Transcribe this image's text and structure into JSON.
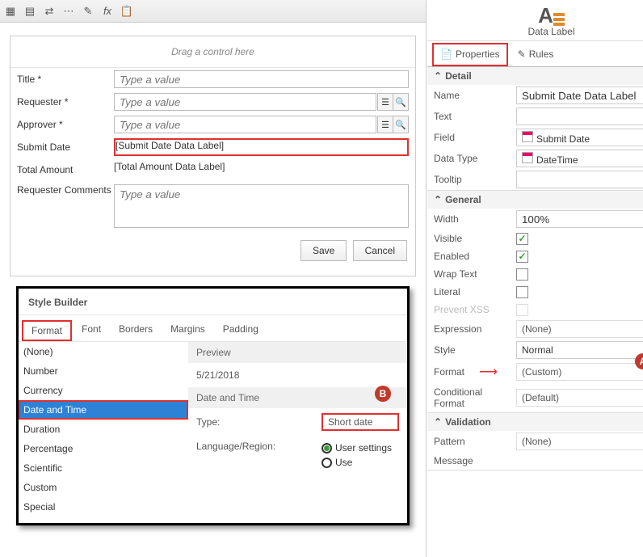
{
  "toolbar_icons": [
    "grid-icon",
    "grid-edit-icon",
    "link-icon",
    "dots-icon",
    "wand-icon",
    "fx-icon",
    "clipboard-icon"
  ],
  "canvas": {
    "drag_hint": "Drag a control here",
    "rows": {
      "title": {
        "label": "Title *",
        "placeholder": "Type a value"
      },
      "requester": {
        "label": "Requester *",
        "placeholder": "Type a value"
      },
      "approver": {
        "label": "Approver *",
        "placeholder": "Type a value"
      },
      "submit": {
        "label": "Submit Date",
        "value": "[Submit Date Data Label]"
      },
      "total": {
        "label": "Total Amount",
        "value": "[Total Amount Data Label]"
      },
      "comments": {
        "label": "Requester Comments",
        "placeholder": "Type a value"
      }
    },
    "buttons": {
      "save": "Save",
      "cancel": "Cancel"
    }
  },
  "style_builder": {
    "title": "Style Builder",
    "tabs": [
      "Format",
      "Font",
      "Borders",
      "Margins",
      "Padding"
    ],
    "cats": [
      "(None)",
      "Number",
      "Currency",
      "Date and Time",
      "Duration",
      "Percentage",
      "Scientific",
      "Custom",
      "Special"
    ],
    "preview_label": "Preview",
    "preview_value": "5/21/2018",
    "section_label": "Date and Time",
    "type_label": "Type:",
    "type_value": "Short date",
    "lang_label": "Language/Region:",
    "lang_opts": [
      "User settings",
      "Use"
    ]
  },
  "right": {
    "header_title": "Data Label",
    "tabs": {
      "properties": "Properties",
      "rules": "Rules"
    },
    "sections": {
      "detail": "Detail",
      "general": "General",
      "validation": "Validation"
    },
    "detail": {
      "name_l": "Name",
      "name_v": "Submit Date Data Label",
      "text_l": "Text",
      "text_v": "",
      "field_l": "Field",
      "field_v": "Submit Date",
      "datatype_l": "Data Type",
      "datatype_v": "DateTime",
      "tooltip_l": "Tooltip",
      "tooltip_v": ""
    },
    "general": {
      "width_l": "Width",
      "width_v": "100%",
      "visible_l": "Visible",
      "visible_v": true,
      "enabled_l": "Enabled",
      "enabled_v": true,
      "wrap_l": "Wrap Text",
      "wrap_v": false,
      "literal_l": "Literal",
      "literal_v": false,
      "prevent_l": "Prevent XSS",
      "expr_l": "Expression",
      "expr_v": "(None)",
      "style_l": "Style",
      "style_v": "Normal",
      "format_l": "Format",
      "format_v": "(Custom)",
      "cond_l": "Conditional Format",
      "cond_v": "(Default)"
    },
    "validation": {
      "pattern_l": "Pattern",
      "pattern_v": "(None)",
      "message_l": "Message"
    }
  },
  "bubbles": {
    "a": "A",
    "b": "B"
  }
}
